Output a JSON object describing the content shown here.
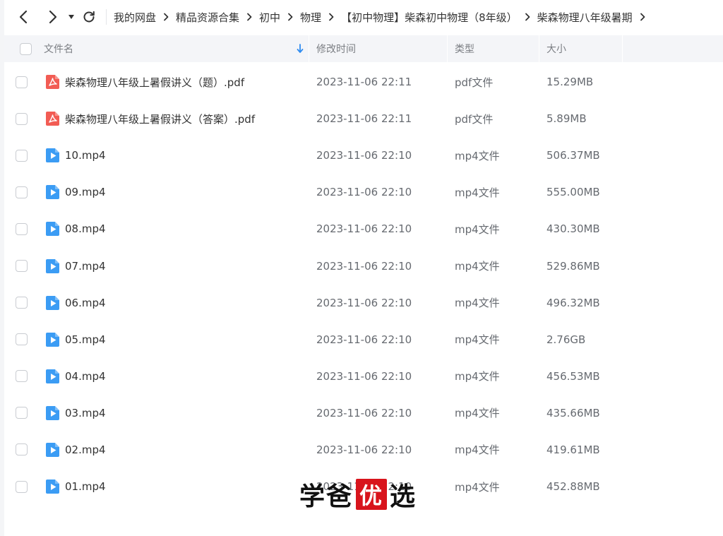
{
  "breadcrumb": [
    "我的网盘",
    "精品资源合集",
    "初中",
    "物理",
    "【初中物理】柴森初中物理（8年级）",
    "柴森物理八年级暑期"
  ],
  "header": {
    "name": "文件名",
    "time": "修改时间",
    "type": "类型",
    "size": "大小"
  },
  "files": [
    {
      "name": "柴森物理八年级上暑假讲义（题）.pdf",
      "time": "2023-11-06 22:11",
      "type": "pdf文件",
      "size": "15.29MB",
      "icon": "pdf-icon"
    },
    {
      "name": "柴森物理八年级上暑假讲义（答案）.pdf",
      "time": "2023-11-06 22:11",
      "type": "pdf文件",
      "size": "5.89MB",
      "icon": "pdf-icon"
    },
    {
      "name": "10.mp4",
      "time": "2023-11-06 22:10",
      "type": "mp4文件",
      "size": "506.37MB",
      "icon": "video-icon"
    },
    {
      "name": "09.mp4",
      "time": "2023-11-06 22:10",
      "type": "mp4文件",
      "size": "555.00MB",
      "icon": "video-icon"
    },
    {
      "name": "08.mp4",
      "time": "2023-11-06 22:10",
      "type": "mp4文件",
      "size": "430.30MB",
      "icon": "video-icon"
    },
    {
      "name": "07.mp4",
      "time": "2023-11-06 22:10",
      "type": "mp4文件",
      "size": "529.86MB",
      "icon": "video-icon"
    },
    {
      "name": "06.mp4",
      "time": "2023-11-06 22:10",
      "type": "mp4文件",
      "size": "496.32MB",
      "icon": "video-icon"
    },
    {
      "name": "05.mp4",
      "time": "2023-11-06 22:10",
      "type": "mp4文件",
      "size": "2.76GB",
      "icon": "video-icon"
    },
    {
      "name": "04.mp4",
      "time": "2023-11-06 22:10",
      "type": "mp4文件",
      "size": "456.53MB",
      "icon": "video-icon"
    },
    {
      "name": "03.mp4",
      "time": "2023-11-06 22:10",
      "type": "mp4文件",
      "size": "435.66MB",
      "icon": "video-icon"
    },
    {
      "name": "02.mp4",
      "time": "2023-11-06 22:10",
      "type": "mp4文件",
      "size": "419.61MB",
      "icon": "video-icon"
    },
    {
      "name": "01.mp4",
      "time": "2023-11-06 22:10",
      "type": "mp4文件",
      "size": "452.88MB",
      "icon": "video-icon"
    }
  ],
  "watermark": {
    "part1": "学爸",
    "boxed": "优",
    "part2": "选"
  },
  "colors": {
    "pdf": "#f25c54",
    "video": "#3b9cf4",
    "header_bg": "#f4f5f8"
  }
}
